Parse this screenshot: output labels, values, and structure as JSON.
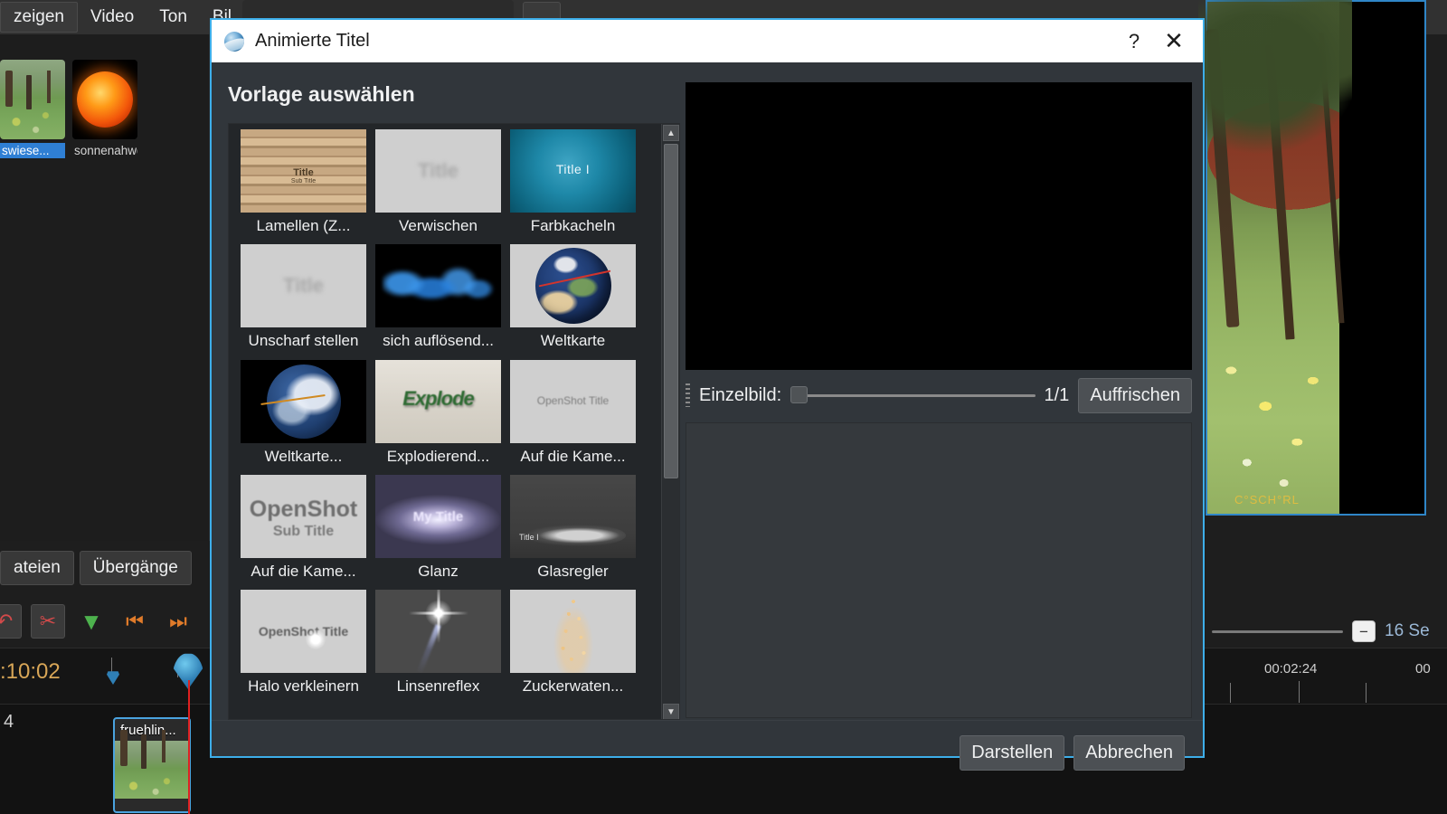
{
  "background": {
    "menu": [
      {
        "label": "zeigen",
        "active": true
      },
      {
        "label": "Video",
        "active": false
      },
      {
        "label": "Ton",
        "active": false
      },
      {
        "label": "Bil",
        "active": false
      }
    ],
    "files": [
      {
        "name": "swiese...",
        "selected": true,
        "thumb": "meadow-thumbnail"
      },
      {
        "name": "sonnenahwdrdp...",
        "selected": false,
        "thumb": "sun-thumbnail"
      }
    ],
    "tabs": [
      {
        "label": "ateien"
      },
      {
        "label": "Übergänge"
      }
    ],
    "toolbar_icons": [
      {
        "name": "undo-icon",
        "glyph": "↶"
      },
      {
        "name": "scissors-icon",
        "glyph": "✂"
      },
      {
        "name": "marker-triangle-icon",
        "glyph": "▼"
      },
      {
        "name": "previous-marker-icon",
        "glyph": "⏮"
      },
      {
        "name": "next-marker-icon",
        "glyph": "⏭"
      }
    ],
    "timecode": ":10:02",
    "ruler_labels": [
      "00:02:24",
      "00"
    ],
    "track_number": "4",
    "clip_name": "fruehlin...",
    "zoom_label": "16 Se",
    "zoom_button_glyph": "−",
    "preview_watermark": "C°SCH°RL"
  },
  "dialog": {
    "title": "Animierte Titel",
    "icon": "openshot-globe-icon",
    "help_label": "?",
    "close_label": "✕",
    "section_title": "Vorlage auswählen",
    "templates": [
      {
        "label": "Lamellen (Z...",
        "art": "t-lamellen",
        "title_text": "Title",
        "sub_text": "Sub Title"
      },
      {
        "label": "Verwischen",
        "art": "t-plain",
        "title_text": "Title",
        "sub_text": ""
      },
      {
        "label": "Farbkacheln",
        "art": "t-farb",
        "title_text": "Title I",
        "sub_text": ""
      },
      {
        "label": "Unscharf stellen",
        "art": "t-plain",
        "title_text": "Title",
        "sub_text": ""
      },
      {
        "label": "sich auflösend...",
        "art": "t-smoke",
        "title_text": "",
        "sub_text": ""
      },
      {
        "label": "Weltkarte",
        "art": "t-globe-light",
        "title_text": "",
        "sub_text": ""
      },
      {
        "label": "Weltkarte...",
        "art": "t-globe-dark",
        "title_text": "",
        "sub_text": ""
      },
      {
        "label": "Explodierend...",
        "art": "t-explode",
        "title_text": "Explode",
        "sub_text": ""
      },
      {
        "label": "Auf die Kame...",
        "art": "t-os-title",
        "title_text": "OpenShot Title",
        "sub_text": ""
      },
      {
        "label": "Auf die Kame...",
        "art": "t-os-big",
        "title_text": "OpenShot",
        "sub_text": "Sub Title"
      },
      {
        "label": "Glanz",
        "art": "t-glanz",
        "title_text": "My Title",
        "sub_text": ""
      },
      {
        "label": "Glasregler",
        "art": "t-glas",
        "title_text": "Title I",
        "sub_text": ""
      },
      {
        "label": "Halo verkleinern",
        "art": "t-halo",
        "title_text": "OpenShot Title",
        "sub_text": ""
      },
      {
        "label": "Linsenreflex",
        "art": "t-lens",
        "title_text": "",
        "sub_text": ""
      },
      {
        "label": "Zuckerwaten...",
        "art": "t-spark",
        "title_text": "",
        "sub_text": ""
      }
    ],
    "scroll_up_glyph": "▲",
    "scroll_down_glyph": "▼",
    "frame_label": "Einzelbild:",
    "frame_count": "1/1",
    "refresh_label": "Auffrischen",
    "render_label": "Darstellen",
    "cancel_label": "Abbrechen"
  },
  "colors": {
    "accent_border": "#3daee9",
    "dialog_bg": "#31363b",
    "button_bg": "#4c5054",
    "text": "#eff0f1",
    "selection": "#2f7fd4",
    "timecode": "#d8a657"
  }
}
